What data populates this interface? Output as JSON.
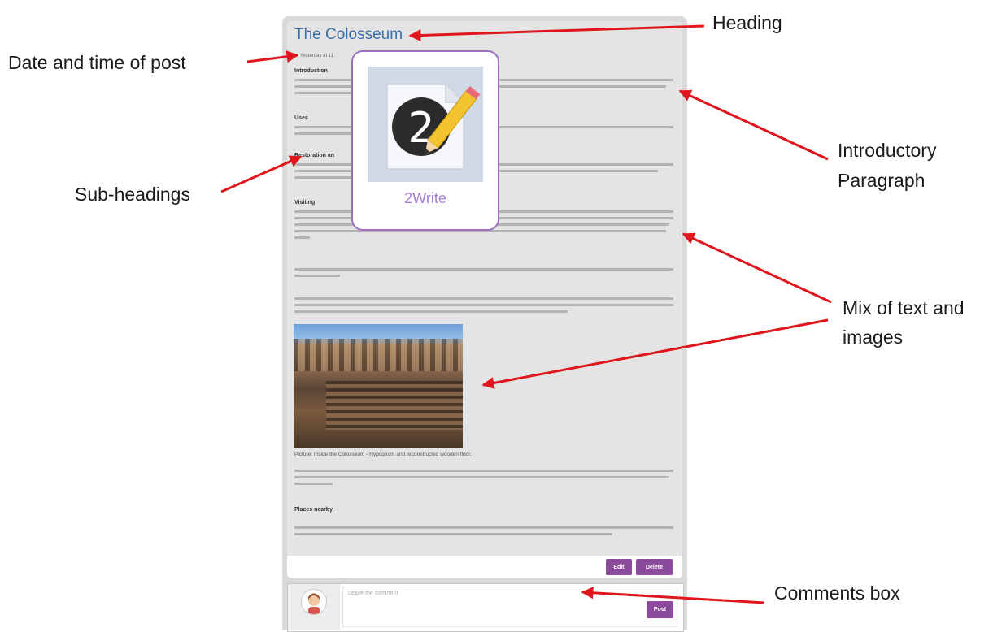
{
  "post": {
    "title": "The Colosseum",
    "date": "Yesterday at 11",
    "sections": {
      "introduction": "Introduction",
      "uses": "Uses",
      "restoration": "Restoration an",
      "visiting": "Visiting",
      "places": "Places nearby"
    },
    "photo_caption": "Picture: Inside the Colosseum - Hypogeum and reconstructed wooden floor."
  },
  "actions": {
    "edit": "Edit",
    "delete": "Delete"
  },
  "comments": {
    "placeholder": "Leave the comment",
    "post": "Post"
  },
  "popup": {
    "label": "2Write",
    "icon": "2write-pencil-icon"
  },
  "annotations": {
    "heading": "Heading",
    "date_time": "Date and time of post",
    "intro_line1": "Introductory",
    "intro_line2": "Paragraph",
    "subheadings": "Sub-headings",
    "mix_line1": "Mix of text and",
    "mix_line2": "images",
    "comments_box": "Comments box"
  },
  "colors": {
    "title": "#3d6ea8",
    "button": "#8c4a9c",
    "popup_border": "#9b6fc2",
    "arrow": "#e0161e"
  }
}
